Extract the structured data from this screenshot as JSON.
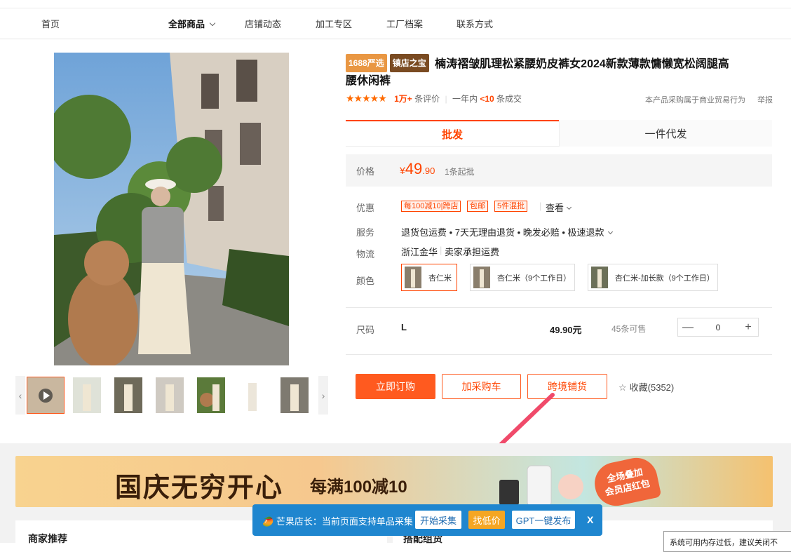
{
  "nav": {
    "items": [
      "首页",
      "全部商品",
      "店铺动态",
      "加工专区",
      "工厂档案",
      "联系方式"
    ]
  },
  "product": {
    "tag1": "1688严选",
    "tag2": "镇店之宝",
    "title_line1": "楠涛褶皱肌理松紧腰奶皮裤女2024新款薄款慵懒宽松阔腿高",
    "title_line2": "腰休闲裤",
    "stars": "★★★★★",
    "review_count": "1万+",
    "review_label": "条评价",
    "year_label": "一年内",
    "deal_count": "<10",
    "deal_label": "条成交",
    "business_note": "本产品采购属于商业贸易行为",
    "report": "举报"
  },
  "tabs": {
    "active": "批发",
    "inactive": "一件代发"
  },
  "price": {
    "label": "价格",
    "currency": "¥",
    "int": "49",
    "dec": ".90",
    "min_order": "1条起批"
  },
  "promo": {
    "label": "优惠",
    "tags": [
      "每100减10|跨店",
      "包邮",
      "5件混批"
    ],
    "view": "查看"
  },
  "service": {
    "label": "服务",
    "text": "退货包运费 • 7天无理由退货 • 晚发必赔 • 极速退款"
  },
  "logistics": {
    "label": "物流",
    "origin": "浙江金华",
    "fee": "卖家承担运费"
  },
  "color": {
    "label": "颜色",
    "options": [
      "杏仁米",
      "杏仁米（9个工作日）",
      "杏仁米-加长款（9个工作日）"
    ]
  },
  "size": {
    "label": "尺码",
    "value": "L",
    "price": "49.90元",
    "stock": "45条可售",
    "qty": "0",
    "minus": "—",
    "plus": "+"
  },
  "actions": {
    "buy": "立即订购",
    "cart": "加采购车",
    "cross": "跨境铺货",
    "fav": "收藏(5352)"
  },
  "banner": {
    "title": "国庆无穷开心",
    "sub": "每满100减10",
    "badge_line1": "全场叠加",
    "badge_line2": "会员店红包"
  },
  "sections": {
    "left": "商家推荐",
    "right": "搭配组货"
  },
  "plugin": {
    "msg": "芒果店长：当前页面支持单品采集",
    "collect": "开始采集",
    "low_price": "找低价",
    "gpt": "GPT一键发布",
    "close": "X"
  },
  "notice": {
    "text": "系统可用内存过低，建议关闭不"
  },
  "colors": {
    "accent": "#ff4400",
    "plugin_bg": "#1f86cf"
  }
}
